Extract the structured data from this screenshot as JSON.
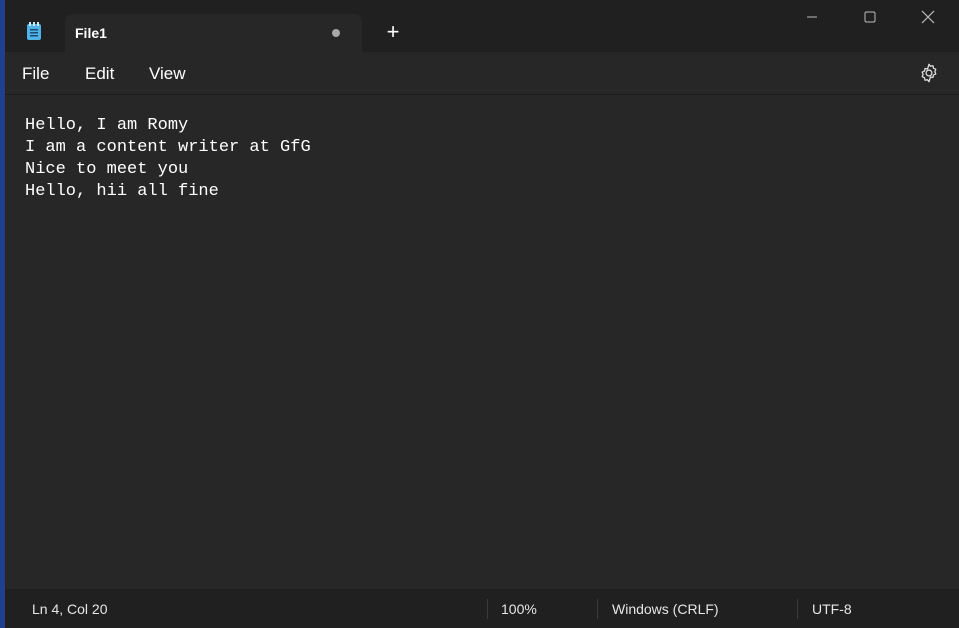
{
  "app": {
    "icon": "notepad-icon"
  },
  "tab": {
    "title": "File1",
    "unsaved_indicator": "unsaved-dot-icon",
    "new_tab": "+"
  },
  "window_controls": [
    "minimize-icon",
    "maximize-icon",
    "close-icon"
  ],
  "menu": {
    "items": [
      {
        "label": "File"
      },
      {
        "label": "Edit"
      },
      {
        "label": "View"
      }
    ],
    "settings_icon": "gear-icon"
  },
  "editor": {
    "lines": [
      "Hello, I am Romy",
      "I am a content writer at GfG",
      "Nice to meet you",
      "Hello, hii all fine"
    ]
  },
  "status": {
    "position": "Ln 4, Col 20",
    "zoom": "100%",
    "line_ending": "Windows (CRLF)",
    "encoding": "UTF-8"
  },
  "colors": {
    "titlebar": "#202020",
    "editor_bg": "#272727",
    "desktop": "#1f3f8f",
    "icon_accent": "#4fb3e8"
  }
}
